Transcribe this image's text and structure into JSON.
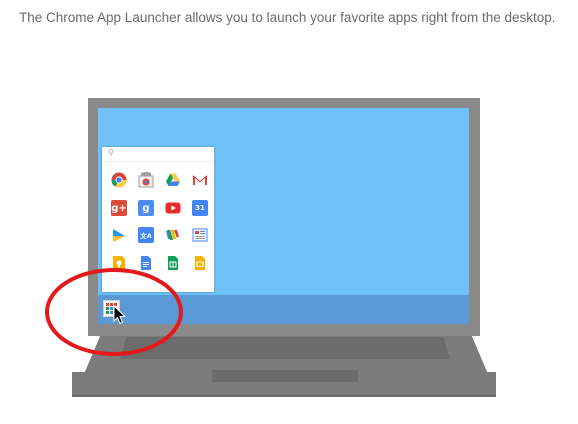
{
  "intro": {
    "text": "The Chrome App Launcher allows you to launch your favorite apps right from the desktop."
  },
  "launcher": {
    "search_icon": "search-icon",
    "apps": [
      {
        "name": "chrome-icon"
      },
      {
        "name": "chrome-web-store-icon"
      },
      {
        "name": "google-drive-icon"
      },
      {
        "name": "gmail-icon"
      },
      {
        "name": "google-plus-icon",
        "glyph": "g+"
      },
      {
        "name": "google-search-icon",
        "glyph": "g"
      },
      {
        "name": "youtube-icon"
      },
      {
        "name": "calendar-icon",
        "glyph": "31"
      },
      {
        "name": "play-books-icon"
      },
      {
        "name": "translate-icon",
        "glyph": "文A"
      },
      {
        "name": "wallet-icon"
      },
      {
        "name": "news-icon"
      },
      {
        "name": "keep-icon"
      },
      {
        "name": "docs-icon"
      },
      {
        "name": "sheets-icon"
      },
      {
        "name": "slides-icon"
      }
    ]
  },
  "colors": {
    "screen": "#6fc1f8",
    "taskbar": "#5a99d5",
    "laptop": "#8a8a8a",
    "highlight_ring": "#e4191a"
  }
}
